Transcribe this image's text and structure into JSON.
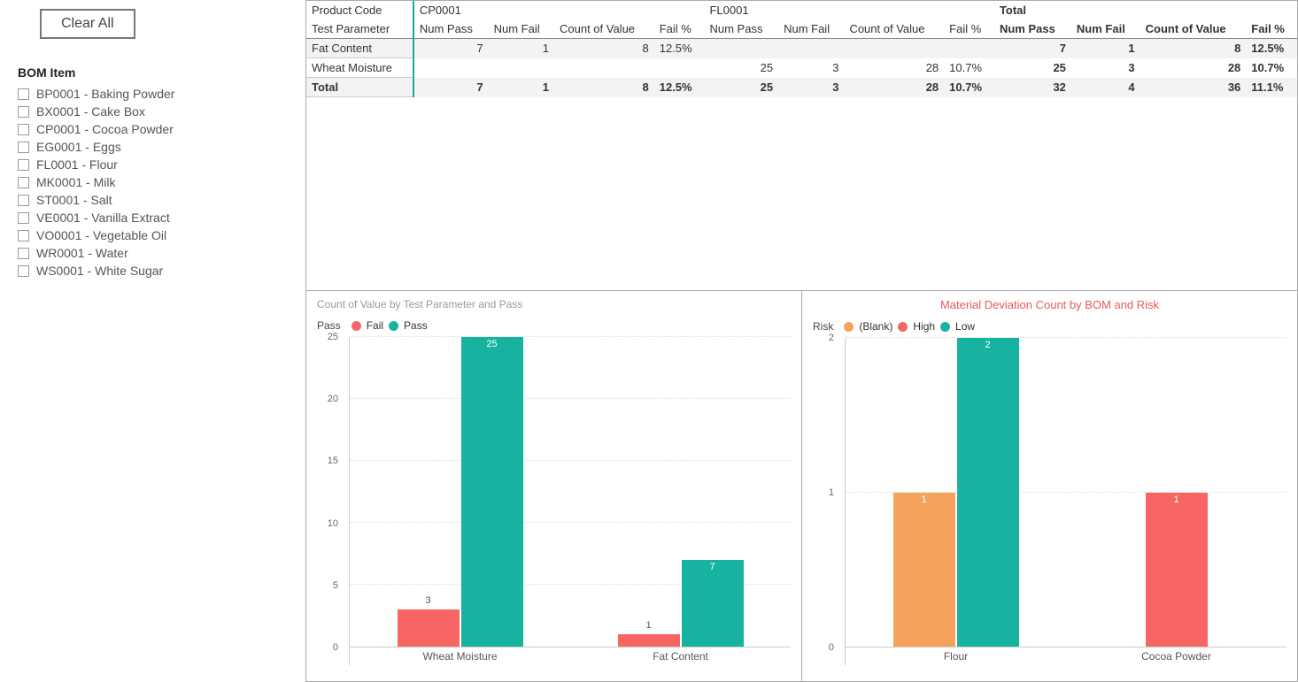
{
  "sidebar": {
    "clear_label": "Clear All",
    "filter_title": "BOM Item",
    "items": [
      {
        "label": "BP0001 - Baking Powder"
      },
      {
        "label": "BX0001 - Cake Box"
      },
      {
        "label": "CP0001 - Cocoa Powder"
      },
      {
        "label": "EG0001 - Eggs"
      },
      {
        "label": "FL0001 - Flour"
      },
      {
        "label": "MK0001 - Milk"
      },
      {
        "label": "ST0001 - Salt"
      },
      {
        "label": "VE0001 - Vanilla Extract"
      },
      {
        "label": "VO0001 - Vegetable Oil"
      },
      {
        "label": "WR0001 - Water"
      },
      {
        "label": "WS0001 - White Sugar"
      }
    ]
  },
  "matrix": {
    "header1_label": "Product Code",
    "header2_label": "Test Parameter",
    "col_groups": [
      "CP0001",
      "FL0001",
      "Total"
    ],
    "sub_cols": [
      "Num Pass",
      "Num Fail",
      "Count of Value",
      "Fail %"
    ],
    "rows": [
      {
        "label": "Fat Content",
        "cp": [
          "7",
          "1",
          "8",
          "12.5%"
        ],
        "fl": [
          "",
          "",
          "",
          ""
        ],
        "tot": [
          "7",
          "1",
          "8",
          "12.5%"
        ]
      },
      {
        "label": "Wheat Moisture",
        "cp": [
          "",
          "",
          "",
          ""
        ],
        "fl": [
          "25",
          "3",
          "28",
          "10.7%"
        ],
        "tot": [
          "25",
          "3",
          "28",
          "10.7%"
        ]
      }
    ],
    "total_row": {
      "label": "Total",
      "cp": [
        "7",
        "1",
        "8",
        "12.5%"
      ],
      "fl": [
        "25",
        "3",
        "28",
        "10.7%"
      ],
      "tot": [
        "32",
        "4",
        "36",
        "11.1%"
      ]
    }
  },
  "chart1": {
    "title": "Count of Value by Test Parameter and Pass",
    "legend_name": "Pass",
    "series_names": [
      "Fail",
      "Pass"
    ],
    "yticks": [
      "25",
      "20",
      "15",
      "10",
      "5",
      "0"
    ]
  },
  "chart2": {
    "title": "Material Deviation Count by BOM and Risk",
    "legend_name": "Risk",
    "series_names": [
      "(Blank)",
      "High",
      "Low"
    ],
    "yticks": [
      "2",
      "1",
      "0"
    ]
  },
  "chart_data": [
    {
      "type": "bar",
      "title": "Count of Value by Test Parameter and Pass",
      "xlabel": "",
      "ylabel": "",
      "ylim": [
        0,
        25
      ],
      "categories": [
        "Wheat Moisture",
        "Fat Content"
      ],
      "series": [
        {
          "name": "Fail",
          "values": [
            3,
            1
          ],
          "color": "#f76565"
        },
        {
          "name": "Pass",
          "values": [
            25,
            7
          ],
          "color": "#18b3a0"
        }
      ]
    },
    {
      "type": "bar",
      "title": "Material Deviation Count by BOM and Risk",
      "xlabel": "",
      "ylabel": "",
      "ylim": [
        0,
        2
      ],
      "categories": [
        "Flour",
        "Cocoa Powder"
      ],
      "series": [
        {
          "name": "(Blank)",
          "values": [
            1,
            null
          ],
          "color": "#f5a35b"
        },
        {
          "name": "High",
          "values": [
            null,
            1
          ],
          "color": "#f76565"
        },
        {
          "name": "Low",
          "values": [
            2,
            null
          ],
          "color": "#18b3a0"
        }
      ]
    }
  ]
}
